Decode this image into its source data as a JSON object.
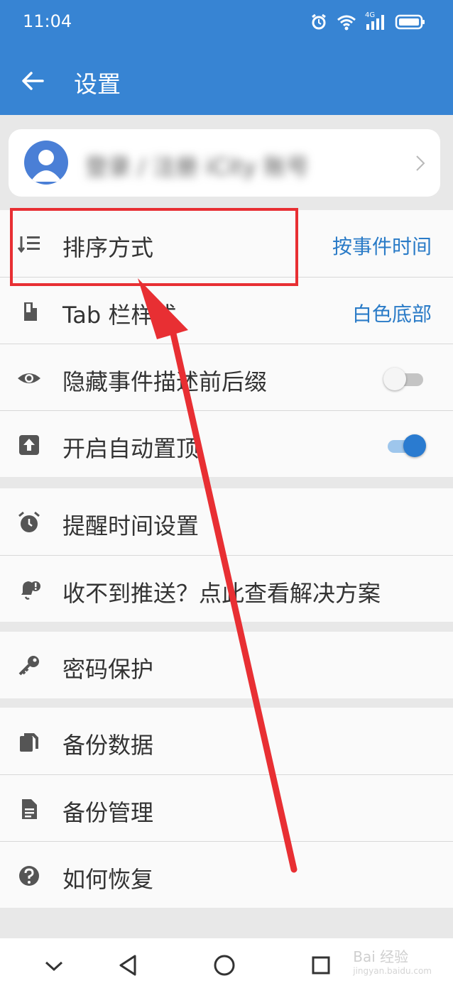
{
  "status_bar": {
    "time": "11:04",
    "network": "4G"
  },
  "app_bar": {
    "title": "设置"
  },
  "account": {
    "text": "登录 / 注册 iCity 账号"
  },
  "groups": [
    {
      "items": [
        {
          "label": "排序方式",
          "value": "按事件时间",
          "icon": "sort-icon"
        },
        {
          "label": "Tab 栏样式",
          "value": "白色底部",
          "icon": "tap-icon"
        },
        {
          "label": "隐藏事件描述前后缀",
          "toggle": false,
          "icon": "eye-icon"
        },
        {
          "label": "开启自动置顶",
          "toggle": true,
          "icon": "upload-icon"
        }
      ]
    },
    {
      "items": [
        {
          "label": "提醒时间设置",
          "icon": "alarm-icon"
        },
        {
          "label": "收不到推送？点此查看解决方案",
          "icon": "notification-alert-icon"
        }
      ]
    },
    {
      "items": [
        {
          "label": "密码保护",
          "icon": "key-icon"
        }
      ]
    },
    {
      "items": [
        {
          "label": "备份数据",
          "icon": "copy-icon"
        },
        {
          "label": "备份管理",
          "icon": "document-icon"
        },
        {
          "label": "如何恢复",
          "icon": "help-icon"
        }
      ]
    }
  ],
  "watermark": {
    "text": "Bai 经验",
    "sub": "jingyan.baidu.com"
  },
  "colors": {
    "primary": "#3784d3",
    "accent_text": "#2a7bc7",
    "highlight": "#e82f33"
  }
}
